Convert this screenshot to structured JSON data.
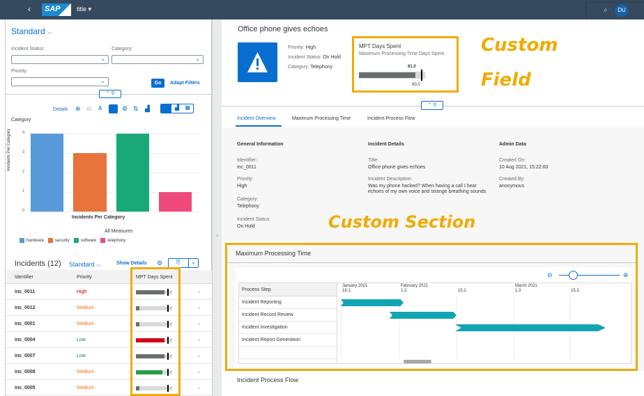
{
  "shell": {
    "title": "title ▾",
    "logo": "SAP",
    "avatar": "DU"
  },
  "filter": {
    "variant": "Standard",
    "status_label": "Incident Status:",
    "category_label": "Category:",
    "priority_label": "Priority:",
    "go_label": "Go",
    "adapt_label": "Adapt Filters"
  },
  "chart_toolbar": {
    "details": "Details"
  },
  "chart_data": {
    "type": "bar",
    "title": "Incidents Per Category",
    "ylabel": "Incidents Per Category",
    "xlabel": "Category",
    "categories": [
      "hardware",
      "security",
      "software",
      "telephony"
    ],
    "values": [
      4,
      3,
      4,
      1
    ],
    "ylim": [
      0,
      4
    ],
    "yticks": [
      "0",
      "1",
      "2",
      "3",
      "4"
    ],
    "colors": [
      "#5899da",
      "#e8743b",
      "#19a979",
      "#ed4a7b"
    ],
    "measures_label": "All Measures"
  },
  "table": {
    "title": "Incidents (12)",
    "variant": "Standard",
    "show_details": "Show Details",
    "headers": [
      "Identifier",
      "Priority",
      "MPT Days Spent"
    ],
    "rows": [
      {
        "id": "inc_0011",
        "priority": "High",
        "color": "#bb0000",
        "fill": 0.9,
        "bar": "#6a6d70"
      },
      {
        "id": "inc_0012",
        "priority": "Medium",
        "color": "#e9730c",
        "fill": 0.1,
        "bar": "#6a6d70"
      },
      {
        "id": "inc_0001",
        "priority": "Medium",
        "color": "#e9730c",
        "fill": 0.1,
        "bar": "#6a6d70"
      },
      {
        "id": "inc_0004",
        "priority": "Low",
        "color": "#107e3e",
        "fill": 0.9,
        "bar": "#d0021b"
      },
      {
        "id": "inc_0007",
        "priority": "Low",
        "color": "#107e3e",
        "fill": 0.9,
        "bar": "#6a6d70"
      },
      {
        "id": "inc_0008",
        "priority": "Medium",
        "color": "#e9730c",
        "fill": 0.85,
        "bar": "#2b9a48"
      },
      {
        "id": "inc_0005",
        "priority": "Medium",
        "color": "#e9730c",
        "fill": 0.1,
        "bar": "#6a6d70"
      }
    ]
  },
  "object": {
    "title": "Office phone gives echoes",
    "priority_label": "Priority:",
    "priority": "High",
    "status_label": "Incident Status:",
    "status": "On Hold",
    "category_label": "Category:",
    "category": "Telephony",
    "mpt_title": "MPT Days Spent",
    "mpt_sub": "Maximum Processing Time Days Spent",
    "mpt_value": "81.0",
    "mpt_target": "90.0",
    "tabs": [
      "Incident Overview",
      "Maximum Processing Time",
      "Incident Process Flow"
    ]
  },
  "overview": {
    "general_h": "General Information",
    "details_h": "Incident Details",
    "admin_h": "Admin Data",
    "identifier_l": "Identifier:",
    "identifier": "inc_0011",
    "priority_l": "Priority:",
    "priority": "High",
    "category_l": "Category:",
    "category": "Telephony",
    "status_l": "Incident Status:",
    "status": "On Hold",
    "title_l": "Title:",
    "title": "Office phone gives echoes",
    "desc_l": "Incident Description:",
    "desc": "Was my phone hacked? When having a call I hear echoes of my own voice and strange breathing sounds",
    "created_on_l": "Created On:",
    "created_on": "10 Aug 2021, 15:22:00",
    "created_by_l": "Created By:",
    "created_by": "anonymous"
  },
  "mpt_section": {
    "title": "Maximum Processing Time",
    "col_header": "Process Step",
    "steps": [
      "Incident Reporting",
      "Incident Record Review",
      "Incident Investigation",
      "Incident Report Generation"
    ],
    "months": [
      "January 2021",
      "February 2021",
      "March 2021"
    ],
    "days": [
      "18.1.",
      "1.2.",
      "15.2.",
      "1.3.",
      "15.3."
    ]
  },
  "flow_title": "Incident Process Flow",
  "annotations": {
    "field": [
      "Custom",
      "Field"
    ],
    "section": "Custom Section"
  }
}
